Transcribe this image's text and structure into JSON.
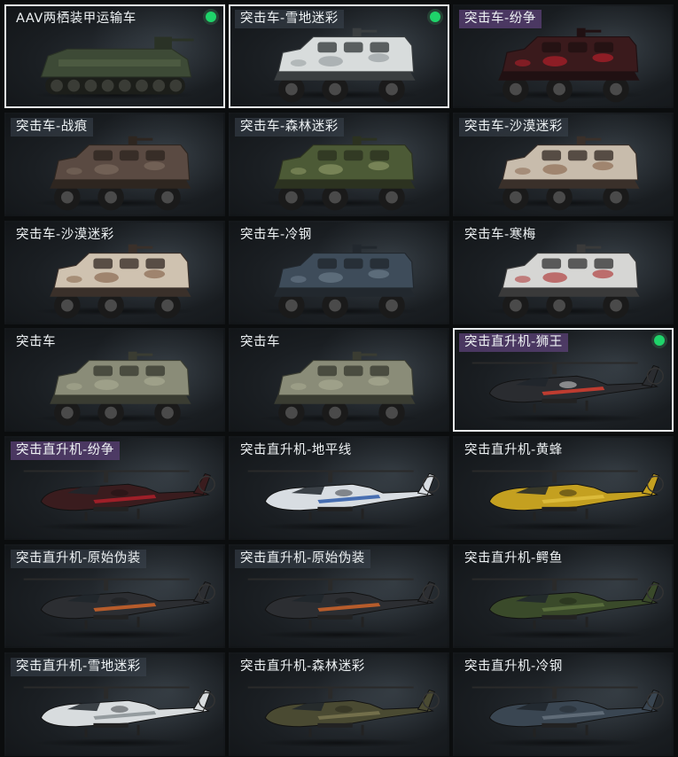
{
  "items": [
    {
      "label": "AAV两栖装甲运输车",
      "kind": "aav",
      "icon": "amphibious-vehicle-icon",
      "tag": "plain",
      "selected": true,
      "equipped": true,
      "colors": [
        "#3d4a36",
        "#56664a",
        "#2a3226"
      ]
    },
    {
      "label": "突击车-雪地迷彩",
      "kind": "car",
      "icon": "assault-vehicle-icon",
      "tag": "gray",
      "selected": true,
      "equipped": true,
      "colors": [
        "#d8dcdc",
        "#9aa0a2",
        "#3a3e40"
      ]
    },
    {
      "label": "突击车-纷争",
      "kind": "car",
      "icon": "assault-vehicle-icon",
      "tag": "purple",
      "selected": false,
      "equipped": false,
      "colors": [
        "#3a1a1c",
        "#b0202a",
        "#201012"
      ]
    },
    {
      "label": "突击车-战痕",
      "kind": "car",
      "icon": "assault-vehicle-icon",
      "tag": "gray",
      "selected": false,
      "equipped": false,
      "colors": [
        "#5a4a42",
        "#7a6a5e",
        "#2e2620"
      ]
    },
    {
      "label": "突击车-森林迷彩",
      "kind": "car",
      "icon": "assault-vehicle-icon",
      "tag": "gray",
      "selected": false,
      "equipped": false,
      "colors": [
        "#4c5a36",
        "#8a9464",
        "#2c3220"
      ]
    },
    {
      "label": "突击车-沙漠迷彩",
      "kind": "car",
      "icon": "assault-vehicle-icon",
      "tag": "gray",
      "selected": false,
      "equipped": false,
      "colors": [
        "#c8bcac",
        "#8e6e56",
        "#3a302a"
      ]
    },
    {
      "label": "突击车-沙漠迷彩",
      "kind": "car",
      "icon": "assault-vehicle-icon",
      "tag": "plain",
      "selected": false,
      "equipped": false,
      "colors": [
        "#cfc2b0",
        "#8a6a52",
        "#3a302a"
      ]
    },
    {
      "label": "突击车-冷钢",
      "kind": "car",
      "icon": "assault-vehicle-icon",
      "tag": "plain",
      "selected": false,
      "equipped": false,
      "colors": [
        "#3e4c5a",
        "#6a7a88",
        "#22282e"
      ]
    },
    {
      "label": "突击车-寒梅",
      "kind": "car",
      "icon": "assault-vehicle-icon",
      "tag": "plain",
      "selected": false,
      "equipped": false,
      "colors": [
        "#d6d6d4",
        "#b04040",
        "#3a3a3a"
      ]
    },
    {
      "label": "突击车",
      "kind": "car",
      "icon": "assault-vehicle-icon",
      "tag": "plain",
      "selected": false,
      "equipped": false,
      "colors": [
        "#8a8c78",
        "#a6a890",
        "#3a3c32"
      ]
    },
    {
      "label": "突击车",
      "kind": "car",
      "icon": "assault-vehicle-icon",
      "tag": "plain",
      "selected": false,
      "equipped": false,
      "colors": [
        "#8a8c78",
        "#a6a890",
        "#3a3c32"
      ]
    },
    {
      "label": "突击直升机-狮王",
      "kind": "heli",
      "icon": "attack-helicopter-icon",
      "tag": "purple",
      "selected": true,
      "equipped": true,
      "colors": [
        "#2a2c30",
        "#d84030",
        "#e6e6e6"
      ]
    },
    {
      "label": "突击直升机-纷争",
      "kind": "heli",
      "icon": "attack-helicopter-icon",
      "tag": "purple",
      "selected": false,
      "equipped": false,
      "colors": [
        "#3a1c1e",
        "#b0202a",
        "#1e1012"
      ]
    },
    {
      "label": "突击直升机-地平线",
      "kind": "heli",
      "icon": "attack-helicopter-icon",
      "tag": "plain",
      "selected": false,
      "equipped": false,
      "colors": [
        "#d8dde2",
        "#2e5aa8",
        "#2a2e34"
      ]
    },
    {
      "label": "突击直升机-黄蜂",
      "kind": "heli",
      "icon": "attack-helicopter-icon",
      "tag": "plain",
      "selected": false,
      "equipped": false,
      "colors": [
        "#c4a020",
        "#e0c040",
        "#2a2410"
      ]
    },
    {
      "label": "突击直升机-原始伪装",
      "kind": "heli",
      "icon": "attack-helicopter-icon",
      "tag": "gray",
      "selected": false,
      "equipped": false,
      "colors": [
        "#2c2e32",
        "#d0642a",
        "#1a1c1e"
      ]
    },
    {
      "label": "突击直升机-原始伪装",
      "kind": "heli",
      "icon": "attack-helicopter-icon",
      "tag": "gray",
      "selected": false,
      "equipped": false,
      "colors": [
        "#2c2e32",
        "#d0642a",
        "#1a1c1e"
      ]
    },
    {
      "label": "突击直升机-鳄鱼",
      "kind": "heli",
      "icon": "attack-helicopter-icon",
      "tag": "plain",
      "selected": false,
      "equipped": false,
      "colors": [
        "#3a4a2a",
        "#5e7240",
        "#1e2616"
      ]
    },
    {
      "label": "突击直升机-雪地迷彩",
      "kind": "heli",
      "icon": "attack-helicopter-icon",
      "tag": "gray",
      "selected": false,
      "equipped": false,
      "colors": [
        "#d8dcde",
        "#8a9094",
        "#2e3236"
      ]
    },
    {
      "label": "突击直升机-森林迷彩",
      "kind": "heli",
      "icon": "attack-helicopter-icon",
      "tag": "plain",
      "selected": false,
      "equipped": false,
      "colors": [
        "#4a4a32",
        "#7a7650",
        "#26261a"
      ]
    },
    {
      "label": "突击直升机-冷钢",
      "kind": "heli",
      "icon": "attack-helicopter-icon",
      "tag": "plain",
      "selected": false,
      "equipped": false,
      "colors": [
        "#3a4652",
        "#66727e",
        "#22282e"
      ]
    }
  ]
}
